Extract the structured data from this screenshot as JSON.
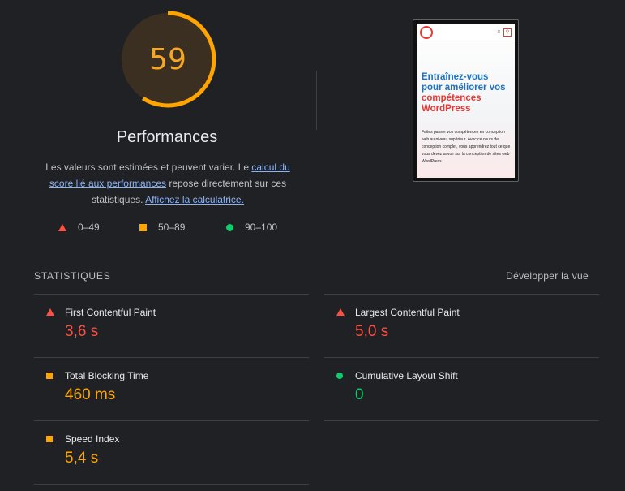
{
  "score": {
    "value": "59",
    "fraction": 0.59,
    "color": "#ffa400",
    "title": "Performances",
    "desc_part1": "Les valeurs sont estimées et peuvent varier. Le ",
    "desc_link1": "calcul du score lié aux performances",
    "desc_part2": " repose directement sur ces statistiques. ",
    "desc_link2": "Affichez la calculatrice."
  },
  "legend": [
    {
      "label": "0–49",
      "icon": "triangle-icon",
      "color": "#ff4e42"
    },
    {
      "label": "50–89",
      "icon": "square-icon",
      "color": "#ffa400"
    },
    {
      "label": "90–100",
      "icon": "circle-icon",
      "color": "#0cce6b"
    }
  ],
  "preview": {
    "headline_line1": "Entraînez-vous",
    "headline_line2": "pour améliorer vos",
    "headline_line3": "compétences",
    "headline_line4": "WordPress",
    "body": "Faites passer vos compétences en conception web au niveau supérieur. Avec ce cours de conception complet, vous apprendrez tout ce que vous devez savoir sur la conception de sites web WordPress.",
    "menu_icon": "≡",
    "search_icon": "⚲"
  },
  "stats": {
    "title": "STATISTIQUES",
    "expand_label": "Développer la vue",
    "metrics": [
      {
        "name": "First Contentful Paint",
        "value": "3,6 s",
        "status": "fail"
      },
      {
        "name": "Largest Contentful Paint",
        "value": "5,0 s",
        "status": "fail"
      },
      {
        "name": "Total Blocking Time",
        "value": "460 ms",
        "status": "average"
      },
      {
        "name": "Cumulative Layout Shift",
        "value": "0",
        "status": "pass"
      },
      {
        "name": "Speed Index",
        "value": "5,4 s",
        "status": "average"
      }
    ]
  }
}
